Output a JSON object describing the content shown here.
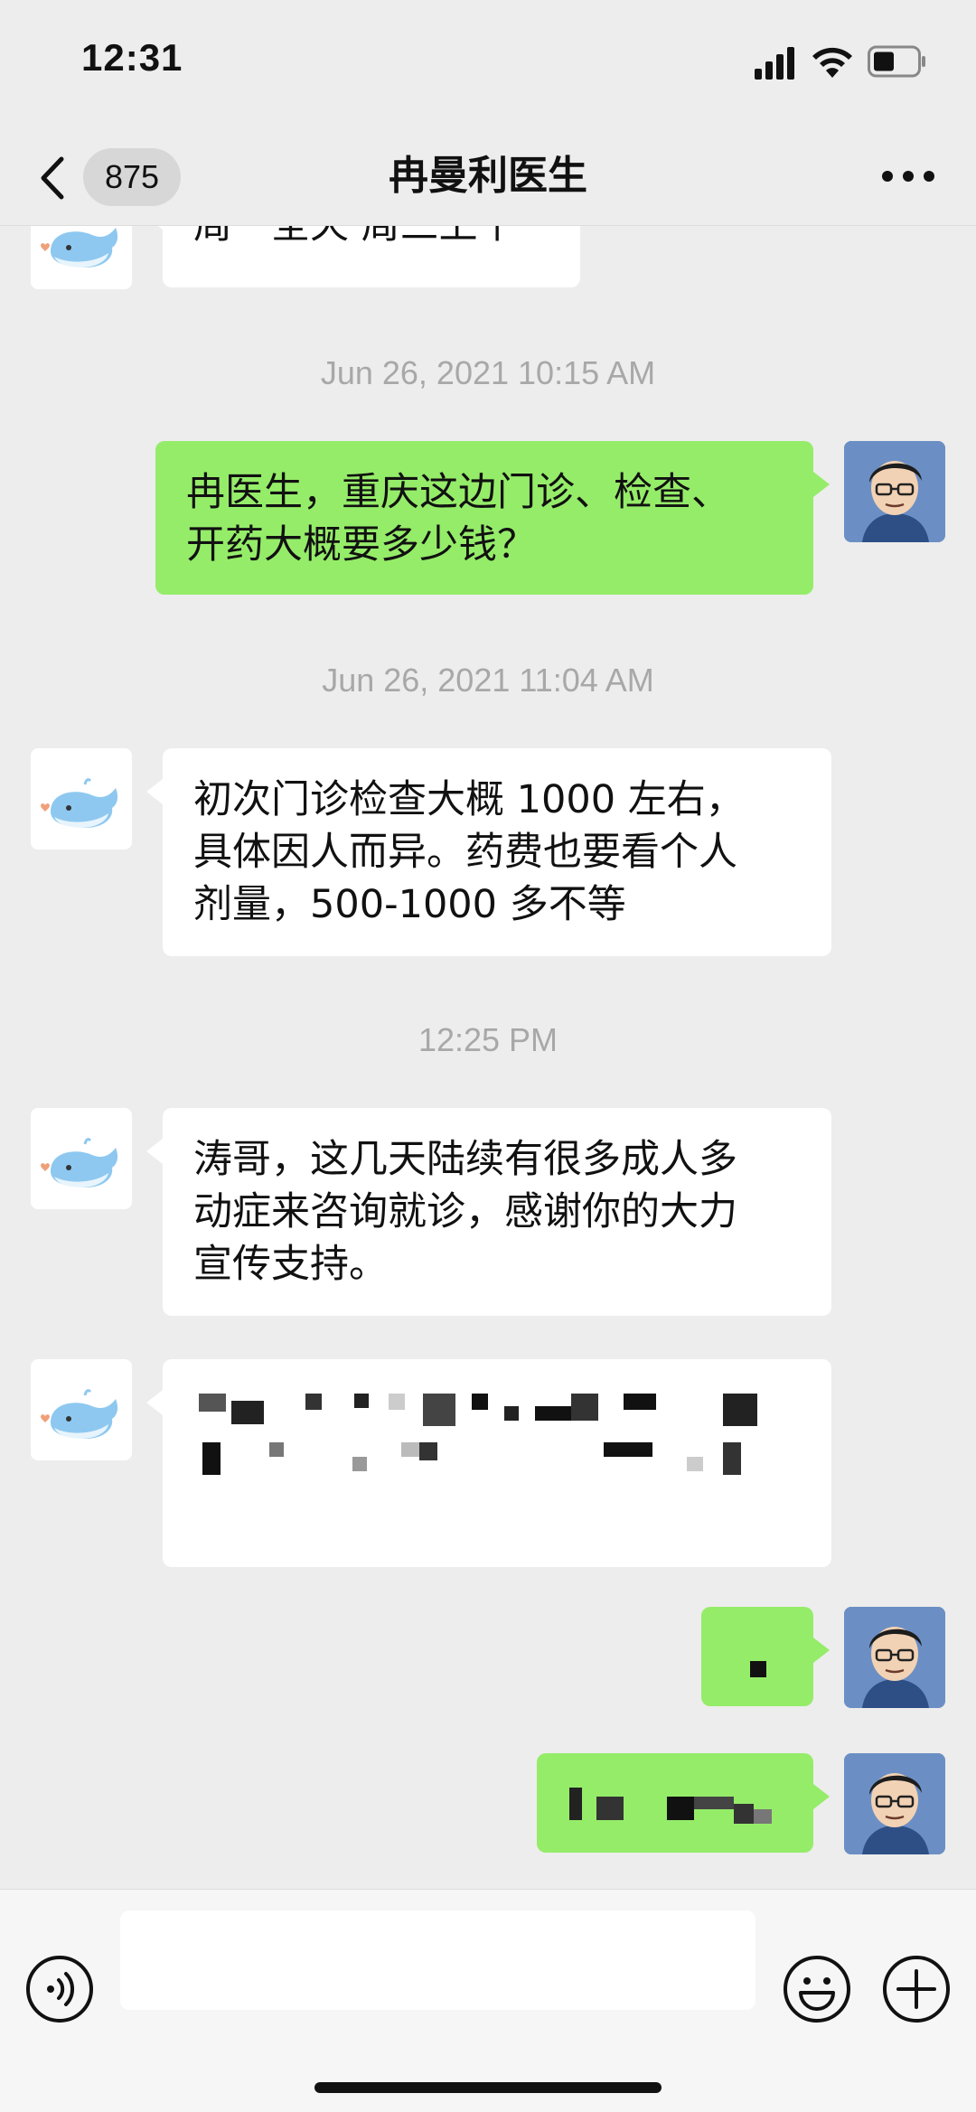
{
  "status_bar": {
    "time": "12:31",
    "icons": [
      "cellular-signal-icon",
      "wifi-icon",
      "battery-icon"
    ]
  },
  "nav": {
    "unread_count": "875",
    "title": "冉曼利医生",
    "back_icon": "chevron-left-icon",
    "more_icon": "more-dots-icon"
  },
  "messages": {
    "m0": {
      "from": "doctor",
      "text": "周一全天 周三上午"
    },
    "t1": "Jun 26, 2021 10:15 AM",
    "m1": {
      "from": "self",
      "line1": "冉医生，重庆这边门诊、检查、",
      "line2": "开药大概要多少钱？"
    },
    "t2": "Jun 26, 2021 11:04 AM",
    "m2": {
      "from": "doctor",
      "line1": "初次门诊检查大概 1000 左右，",
      "line2": "具体因人而异。药费也要看个人",
      "line3": "剂量，500-1000 多不等"
    },
    "t3": "12:25 PM",
    "m3": {
      "from": "doctor",
      "line1": "涛哥，这几天陆续有很多成人多",
      "line2": "动症来咨询就诊，感谢你的大力",
      "line3": "宣传支持。"
    },
    "m4": {
      "from": "doctor",
      "redacted": true
    },
    "m5": {
      "from": "self",
      "redacted": true
    },
    "m6": {
      "from": "self",
      "redacted": true
    }
  },
  "input_bar": {
    "voice_icon": "voice-icon",
    "emoji_icon": "emoji-icon",
    "plus_icon": "plus-icon"
  },
  "colors": {
    "background": "#ededed",
    "bubble_in": "#ffffff",
    "bubble_out": "#95ec69",
    "timestamp": "#a8a8a8"
  }
}
